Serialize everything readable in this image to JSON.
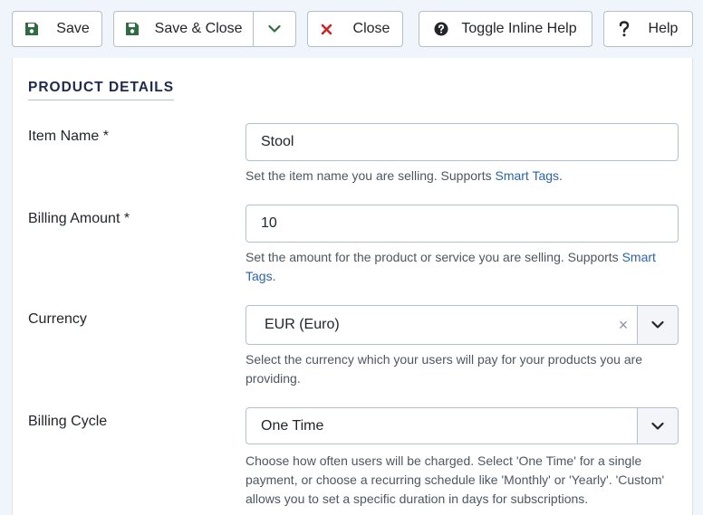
{
  "toolbar": {
    "save_label": "Save",
    "save_close_label": "Save & Close",
    "close_label": "Close",
    "toggle_help_label": "Toggle Inline Help",
    "help_label": "Help"
  },
  "section": {
    "title": "PRODUCT DETAILS"
  },
  "fields": {
    "item_name": {
      "label": "Item Name *",
      "value": "Stool",
      "help_text": "Set the item name you are selling. Supports ",
      "help_link": "Smart Tags",
      "help_after": "."
    },
    "billing_amount": {
      "label": "Billing Amount *",
      "value": "10",
      "help_text": "Set the amount for the product or service you are selling. Supports ",
      "help_link": "Smart Tags",
      "help_after": "."
    },
    "currency": {
      "label": "Currency",
      "value": "EUR (Euro)",
      "clear_glyph": "×",
      "help_text": "Select the currency which your users will pay for your products you are providing."
    },
    "billing_cycle": {
      "label": "Billing Cycle",
      "value": "One Time",
      "help_text": "Choose how often users will be charged. Select 'One Time' for a single payment, or choose a recurring schedule like 'Monthly' or 'Yearly'. 'Custom' allows you to set a specific duration in days for subscriptions."
    }
  },
  "icons": {
    "save": "floppy-disk-icon",
    "dropdown": "chevron-down-icon",
    "close": "x-icon",
    "toggle_help": "question-circle-icon",
    "help": "question-mark-icon"
  },
  "colors": {
    "save_icon": "#2f6c41",
    "close_icon": "#c52827",
    "link": "#2a64a8",
    "section_title": "#1b2a4e",
    "background": "#f0f4fb"
  }
}
